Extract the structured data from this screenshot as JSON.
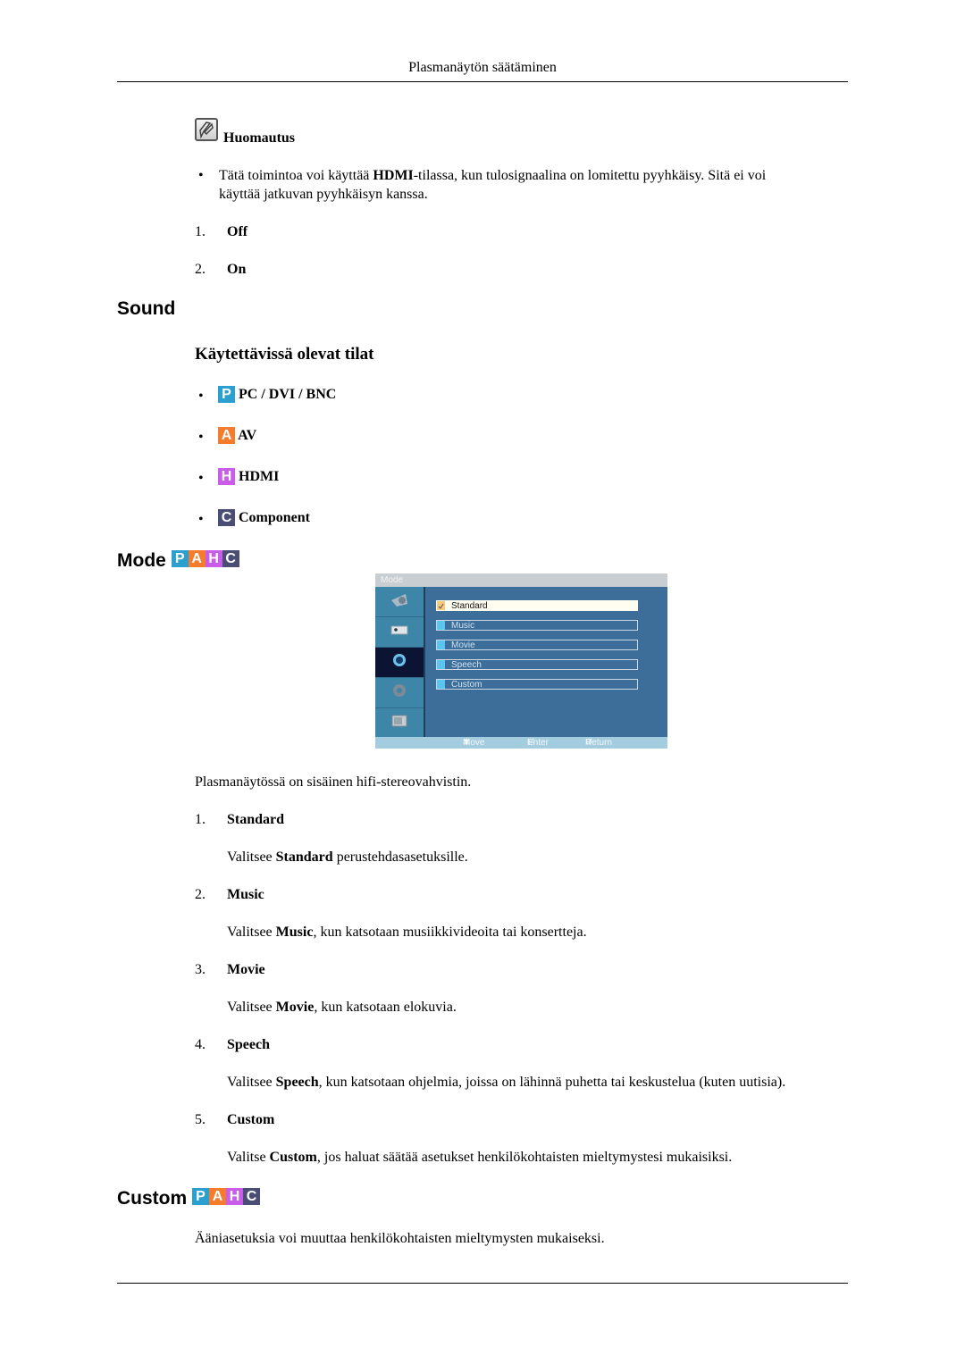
{
  "page_header": {
    "title": "Plasmanäytön säätäminen"
  },
  "note": {
    "icon": "note-pencil-icon",
    "heading": "Huomautus",
    "bullet": {
      "before": "Tätä toimintoa voi käyttää ",
      "bold": "HDMI",
      "after_line1": "-tilassa, kun tulosignaalina on lomitettu pyyhkäisy. Sitä ei voi",
      "line2": "käyttää jatkuvan pyyhkäisyn kanssa."
    }
  },
  "options_list": [
    {
      "num": "1.",
      "label": "Off"
    },
    {
      "num": "2.",
      "label": "On"
    }
  ],
  "sound_section": {
    "title": "Sound",
    "subtitle": "Käytettävissä olevat tilat",
    "modes": [
      {
        "badge": "P",
        "label": "PC / DVI / BNC",
        "color": "#2a9fd0"
      },
      {
        "badge": "A",
        "label": "AV",
        "color": "#f47c2c"
      },
      {
        "badge": "H",
        "label": "HDMI",
        "color": "#c95ce8"
      },
      {
        "badge": "C",
        "label": "Component",
        "color": "#4a4d74"
      }
    ]
  },
  "mode_section": {
    "title": "Mode",
    "badges": [
      "P",
      "A",
      "H",
      "C"
    ],
    "osd": {
      "title": "Mode",
      "side_tabs": [
        "picture-icon",
        "input-icon",
        "sound-icon",
        "setup-icon",
        "multi-control-icon"
      ],
      "active_tab": 2,
      "items": [
        "Standard",
        "Music",
        "Movie",
        "Speech",
        "Custom"
      ],
      "selected_item": 0,
      "footer": {
        "move": "Move",
        "enter": "Enter",
        "return": "Return"
      }
    },
    "intro": "Plasmanäytössä on sisäinen hifi-stereovahvistin.",
    "items": [
      {
        "num": "1.",
        "label": "Standard",
        "desc_before": "Valitsee ",
        "desc_bold": "Standard",
        "desc_after": " perustehdasasetuksille."
      },
      {
        "num": "2.",
        "label": "Music",
        "desc_before": "Valitsee ",
        "desc_bold": "Music",
        "desc_after": ", kun katsotaan musiikkivideoita tai konsertteja."
      },
      {
        "num": "3.",
        "label": "Movie",
        "desc_before": "Valitsee ",
        "desc_bold": "Movie",
        "desc_after": ", kun katsotaan elokuvia."
      },
      {
        "num": "4.",
        "label": "Speech",
        "desc_before": "Valitsee ",
        "desc_bold": "Speech",
        "desc_after": ", kun katsotaan ohjelmia, joissa on lähinnä puhetta tai keskustelua (kuten uutisia)."
      },
      {
        "num": "5.",
        "label": "Custom",
        "desc_before": "Valitse ",
        "desc_bold": "Custom",
        "desc_after": ", jos haluat säätää asetukset henkilökohtaisten mieltymystesi mukaisiksi."
      }
    ]
  },
  "custom_section": {
    "title": "Custom",
    "badges": [
      "P",
      "A",
      "H",
      "C"
    ],
    "text": "Ääniasetuksia voi muuttaa henkilökohtaisten mieltymysten mukaiseksi."
  },
  "badge_colors": {
    "P": "#2a9fd0",
    "A": "#f47c2c",
    "H": "#c95ce8",
    "C": "#4a4d74"
  }
}
